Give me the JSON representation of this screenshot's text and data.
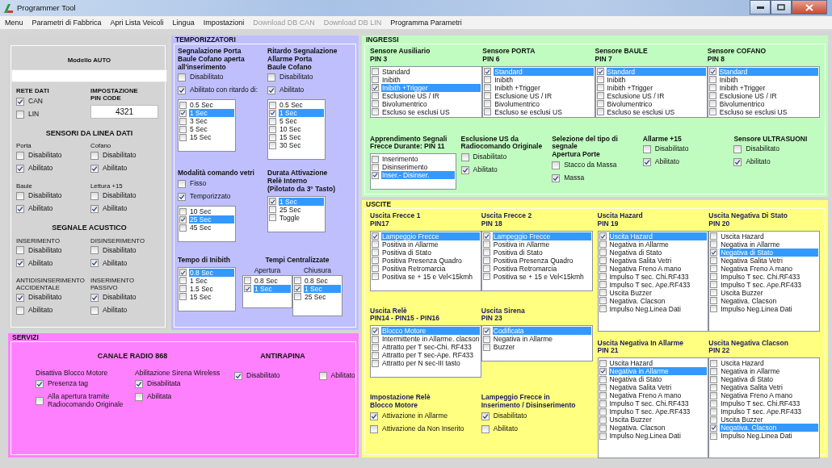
{
  "window": {
    "title": "Programmer Tool"
  },
  "menu": [
    {
      "label": "Menu",
      "disabled": false
    },
    {
      "label": "Parametri di Fabbrica",
      "disabled": false
    },
    {
      "label": "Apri Lista Veicoli",
      "disabled": false
    },
    {
      "label": "Lingua",
      "disabled": false
    },
    {
      "label": "Impostazioni",
      "disabled": false
    },
    {
      "label": "Download DB CAN",
      "disabled": true
    },
    {
      "label": "Download DB LIN",
      "disabled": true
    },
    {
      "label": "Programma Parametri",
      "disabled": false
    }
  ],
  "panels": [
    {
      "color": "#d4d4d4",
      "columns": [
        {
          "rows": [
            {
              "groups": [
                {
                  "kind": "combo",
                  "heading": [
                    "Modello AUTO"
                  ],
                  "bold": true
                }
              ]
            },
            {
              "groups": [
                {
                  "kind": "checks",
                  "heading": [
                    "RETE DATI"
                  ],
                  "bold": true,
                  "items": [
                    {
                      "label": "CAN",
                      "checked": true
                    },
                    {
                      "label": "LIN",
                      "checked": false
                    }
                  ]
                },
                {
                  "kind": "field",
                  "heading": [
                    "IMPOSTAZIONE",
                    "PIN CODE"
                  ],
                  "bold": true,
                  "value": "4321"
                }
              ]
            },
            {
              "groups": [
                {
                  "kind": "title",
                  "heading": [
                    "SENSORI DA LINEA DATI"
                  ],
                  "bold": true
                }
              ]
            },
            {
              "groups": [
                {
                  "kind": "checks",
                  "heading": [
                    "Porta"
                  ],
                  "bold": false,
                  "items": [
                    {
                      "label": "Disabilitato",
                      "checked": false
                    },
                    {
                      "label": "Abilitato",
                      "checked": true
                    }
                  ]
                },
                {
                  "kind": "checks",
                  "heading": [
                    "Cofano"
                  ],
                  "bold": false,
                  "items": [
                    {
                      "label": "Disabilitato",
                      "checked": false
                    },
                    {
                      "label": "Abilitato",
                      "checked": true
                    }
                  ]
                }
              ]
            },
            {
              "groups": [
                {
                  "kind": "checks",
                  "heading": [
                    "Baule"
                  ],
                  "bold": false,
                  "items": [
                    {
                      "label": "Disabilitato",
                      "checked": false
                    },
                    {
                      "label": "Abilitato",
                      "checked": true
                    }
                  ]
                },
                {
                  "kind": "checks",
                  "heading": [
                    "Lettura +15"
                  ],
                  "bold": false,
                  "items": [
                    {
                      "label": "Disabilitato",
                      "checked": false
                    },
                    {
                      "label": "Abilitato",
                      "checked": true
                    }
                  ]
                }
              ]
            },
            {
              "groups": [
                {
                  "kind": "title",
                  "heading": [
                    "SEGNALE ACUSTICO"
                  ],
                  "bold": true
                }
              ]
            },
            {
              "groups": [
                {
                  "kind": "checks",
                  "heading": [
                    "INSERIMENTO"
                  ],
                  "bold": false,
                  "items": [
                    {
                      "label": "Disabilitato",
                      "checked": false
                    },
                    {
                      "label": "Abilitato",
                      "checked": true
                    }
                  ]
                },
                {
                  "kind": "checks",
                  "heading": [
                    "DISINSERIMENTO"
                  ],
                  "bold": false,
                  "items": [
                    {
                      "label": "Disabilitato",
                      "checked": false
                    },
                    {
                      "label": "Abilitato",
                      "checked": true
                    }
                  ]
                }
              ]
            },
            {
              "groups": [
                {
                  "kind": "checks",
                  "heading": [
                    "ANTIDISINSERIMENTO",
                    "ACCIDENTALE"
                  ],
                  "bold": false,
                  "items": [
                    {
                      "label": "Disabilitato",
                      "checked": true
                    },
                    {
                      "label": "Abilitato",
                      "checked": false
                    }
                  ]
                },
                {
                  "kind": "checks",
                  "heading": [
                    "INSERIMENTO",
                    "PASSIVO"
                  ],
                  "bold": false,
                  "items": [
                    {
                      "label": "Disabilitato",
                      "checked": true
                    },
                    {
                      "label": "Abilitato",
                      "checked": false
                    }
                  ]
                }
              ]
            }
          ]
        }
      ]
    },
    {
      "title": "TEMPORIZZATORI",
      "color": "#bfbffd",
      "columns": [
        {
          "rows": [
            {
              "groups": [
                {
                  "kind": "checks-list",
                  "heading": [
                    "Segnalazione Porta",
                    "Baule Cofano aperta",
                    "all'inserimento"
                  ],
                  "bold": true,
                  "items": [
                    {
                      "label": "Disabilitato",
                      "checked": false
                    },
                    {
                      "label": "Abilitato con ritardo di:",
                      "checked": true
                    }
                  ],
                  "list": [
                    {
                      "label": "0.5 Sec",
                      "checked": false,
                      "selected": false
                    },
                    {
                      "label": "1 Sec",
                      "checked": true,
                      "selected": true
                    },
                    {
                      "label": "3 Sec",
                      "checked": false,
                      "selected": false
                    },
                    {
                      "label": "5 Sec",
                      "checked": false,
                      "selected": false
                    },
                    {
                      "label": "15 Sec",
                      "checked": false,
                      "selected": false
                    }
                  ]
                },
                {
                  "kind": "checks-list",
                  "heading": [
                    "Ritardo Segnalazione",
                    "Allarme Porta",
                    "Baule Cofano"
                  ],
                  "bold": true,
                  "items": [
                    {
                      "label": "Disabilitato",
                      "checked": false
                    },
                    {
                      "label": "Abilitato",
                      "checked": true
                    }
                  ],
                  "list": [
                    {
                      "label": "0.5 Sec",
                      "checked": false,
                      "selected": false
                    },
                    {
                      "label": "1 Sec",
                      "checked": true,
                      "selected": true
                    },
                    {
                      "label": "5 Sec",
                      "checked": false,
                      "selected": false
                    },
                    {
                      "label": "10 Sec",
                      "checked": false,
                      "selected": false
                    },
                    {
                      "label": "15 Sec",
                      "checked": false,
                      "selected": false
                    },
                    {
                      "label": "30 Sec",
                      "checked": false,
                      "selected": false
                    }
                  ]
                }
              ]
            },
            {
              "groups": [
                {
                  "kind": "checks-list",
                  "heading": [
                    "Modalità comando vetri"
                  ],
                  "bold": true,
                  "items": [
                    {
                      "label": "Fisso",
                      "checked": false
                    },
                    {
                      "label": "Temporizzato",
                      "checked": true
                    }
                  ],
                  "list": [
                    {
                      "label": "10 Sec",
                      "checked": false,
                      "selected": false
                    },
                    {
                      "label": "25 Sec",
                      "checked": true,
                      "selected": true
                    },
                    {
                      "label": "45 Sec",
                      "checked": false,
                      "selected": false
                    }
                  ]
                },
                {
                  "kind": "list",
                  "heading": [
                    "Durata Attivazione",
                    "Relè Interno",
                    "(Pilotato da 3° Tasto)"
                  ],
                  "bold": true,
                  "list": [
                    {
                      "label": "1 Sec",
                      "checked": true,
                      "selected": true
                    },
                    {
                      "label": "25 Sec",
                      "checked": false,
                      "selected": false
                    },
                    {
                      "label": "Toggle",
                      "checked": false,
                      "selected": false
                    }
                  ]
                }
              ]
            },
            {
              "groups": [
                {
                  "kind": "list",
                  "heading": [
                    "Tempo di Inibith"
                  ],
                  "bold": true,
                  "list": [
                    {
                      "label": "0.8 Sec",
                      "checked": true,
                      "selected": true
                    },
                    {
                      "label": "1 Sec",
                      "checked": false,
                      "selected": false
                    },
                    {
                      "label": "1.5 Sec",
                      "checked": false,
                      "selected": false
                    },
                    {
                      "label": "15 Sec",
                      "checked": false,
                      "selected": false
                    }
                  ]
                },
                {
                  "kind": "split",
                  "heading": [
                    "Tempi Centralizzate"
                  ],
                  "bold": true,
                  "parts": [
                    {
                      "heading": [
                        "Apertura"
                      ],
                      "bold": false,
                      "list": [
                        {
                          "label": "0.8 Sec",
                          "checked": false,
                          "selected": false
                        },
                        {
                          "label": "1 Sec",
                          "checked": true,
                          "selected": true
                        }
                      ]
                    },
                    {
                      "heading": [
                        "Chiusura"
                      ],
                      "bold": false,
                      "list": [
                        {
                          "label": "0.8 Sec",
                          "checked": false,
                          "selected": false
                        },
                        {
                          "label": "1 Sec",
                          "checked": true,
                          "selected": true
                        },
                        {
                          "label": "25 Sec",
                          "checked": false,
                          "selected": false
                        }
                      ]
                    }
                  ]
                }
              ]
            }
          ]
        }
      ]
    },
    {
      "title": "INGRESSI",
      "color": "#c0fcc0",
      "columns": [
        {
          "rows": [
            {
              "groups": [
                {
                  "kind": "list",
                  "heading": [
                    "Sensore Ausiliario",
                    "PIN 3"
                  ],
                  "bold": true,
                  "list": [
                    {
                      "label": "Standard",
                      "checked": false,
                      "selected": false
                    },
                    {
                      "label": "Inibith",
                      "checked": false,
                      "selected": false
                    },
                    {
                      "label": "Inibith +Trigger",
                      "checked": true,
                      "selected": true
                    },
                    {
                      "label": "Esclusione US / IR",
                      "checked": false,
                      "selected": false
                    },
                    {
                      "label": "Bivolumentrico",
                      "checked": false,
                      "selected": false
                    },
                    {
                      "label": "Escluso se esclusi US",
                      "checked": false,
                      "selected": false
                    }
                  ]
                },
                {
                  "kind": "list",
                  "heading": [
                    "Sensore PORTA",
                    "PIN 6"
                  ],
                  "bold": true,
                  "list": [
                    {
                      "label": "Standard",
                      "checked": true,
                      "selected": true
                    },
                    {
                      "label": "Inibith",
                      "checked": false,
                      "selected": false
                    },
                    {
                      "label": "Inibith +Trigger",
                      "checked": false,
                      "selected": false
                    },
                    {
                      "label": "Esclusione US / IR",
                      "checked": false,
                      "selected": false
                    },
                    {
                      "label": "Bivolumentrico",
                      "checked": false,
                      "selected": false
                    },
                    {
                      "label": "Escluso se esclusi US",
                      "checked": false,
                      "selected": false
                    }
                  ]
                },
                {
                  "kind": "list",
                  "heading": [
                    "Sensore BAULE",
                    "PIN 7"
                  ],
                  "bold": true,
                  "list": [
                    {
                      "label": "Standard",
                      "checked": true,
                      "selected": true
                    },
                    {
                      "label": "Inibith",
                      "checked": false,
                      "selected": false
                    },
                    {
                      "label": "Inibith +Trigger",
                      "checked": false,
                      "selected": false
                    },
                    {
                      "label": "Esclusione US / IR",
                      "checked": false,
                      "selected": false
                    },
                    {
                      "label": "Bivolumentrico",
                      "checked": false,
                      "selected": false
                    },
                    {
                      "label": "Escluso se esclusi US",
                      "checked": false,
                      "selected": false
                    }
                  ]
                },
                {
                  "kind": "list",
                  "heading": [
                    "Sensore COFANO",
                    "PIN 8"
                  ],
                  "bold": true,
                  "list": [
                    {
                      "label": "Standard",
                      "checked": true,
                      "selected": true
                    },
                    {
                      "label": "Inibith",
                      "checked": false,
                      "selected": false
                    },
                    {
                      "label": "Inibith +Trigger",
                      "checked": false,
                      "selected": false
                    },
                    {
                      "label": "Esclusione US / IR",
                      "checked": false,
                      "selected": false
                    },
                    {
                      "label": "Bivolumentrico",
                      "checked": false,
                      "selected": false
                    },
                    {
                      "label": "Escluso se esclusi US",
                      "checked": false,
                      "selected": false
                    }
                  ]
                }
              ]
            },
            {
              "groups": [
                {
                  "kind": "list",
                  "heading": [
                    "Apprendimento Segnali",
                    "Frecce Durante:   PIN 11"
                  ],
                  "bold": true,
                  "list": [
                    {
                      "label": "Inserimento",
                      "checked": false,
                      "selected": false
                    },
                    {
                      "label": "Disinserimento",
                      "checked": false,
                      "selected": false
                    },
                    {
                      "label": "Inser.- Disinser.",
                      "checked": true,
                      "selected": true
                    }
                  ]
                },
                {
                  "kind": "checks",
                  "heading": [
                    "Esclusione US da",
                    "Radiocomando Originale"
                  ],
                  "bold": true,
                  "items": [
                    {
                      "label": "Disabilitato",
                      "checked": false
                    },
                    {
                      "label": "Abilitato",
                      "checked": true
                    }
                  ]
                },
                {
                  "kind": "checks",
                  "heading": [
                    "Selezione del tipo di segnale",
                    "Apertura Porte"
                  ],
                  "bold": true,
                  "items": [
                    {
                      "label": "Stacco da Massa",
                      "checked": false
                    },
                    {
                      "label": "Massa",
                      "checked": true
                    }
                  ]
                },
                {
                  "kind": "checks",
                  "heading": [
                    "Allarme +15"
                  ],
                  "bold": true,
                  "items": [
                    {
                      "label": "Disabilitato",
                      "checked": false
                    },
                    {
                      "label": "Abilitato",
                      "checked": true
                    }
                  ]
                },
                {
                  "kind": "checks",
                  "heading": [
                    "Sensore ULTRASUONI"
                  ],
                  "bold": true,
                  "items": [
                    {
                      "label": "Disabilitato",
                      "checked": false
                    },
                    {
                      "label": "Abilitato",
                      "checked": true
                    }
                  ]
                }
              ]
            }
          ]
        }
      ]
    },
    {
      "title": "USCITE",
      "color": "#ffff80",
      "columns": [
        {
          "rows": [
            {
              "groups": [
                {
                  "kind": "list",
                  "heading": [
                    "Uscita Frecce 1",
                    "PIN17"
                  ],
                  "bold": true,
                  "list": [
                    {
                      "label": "Lampeggio Frecce",
                      "checked": true,
                      "selected": true
                    },
                    {
                      "label": "Positiva in Allarme",
                      "checked": false,
                      "selected": false
                    },
                    {
                      "label": "Positiva di Stato",
                      "checked": false,
                      "selected": false
                    },
                    {
                      "label": "Positiva Presenza Quadro",
                      "checked": false,
                      "selected": false
                    },
                    {
                      "label": "Positiva Retromarcia",
                      "checked": false,
                      "selected": false
                    },
                    {
                      "label": "Positiva se + 15 e Vel<15kmh",
                      "checked": false,
                      "selected": false
                    }
                  ]
                },
                {
                  "kind": "list",
                  "heading": [
                    "Uscita Frecce 2",
                    "PIN 18"
                  ],
                  "bold": true,
                  "list": [
                    {
                      "label": "Lampeggio Frecce",
                      "checked": true,
                      "selected": true
                    },
                    {
                      "label": "Positiva in Allarme",
                      "checked": false,
                      "selected": false
                    },
                    {
                      "label": "Positiva di Stato",
                      "checked": false,
                      "selected": false
                    },
                    {
                      "label": "Positiva Presenza Quadro",
                      "checked": false,
                      "selected": false
                    },
                    {
                      "label": "Positiva Retromarcia",
                      "checked": false,
                      "selected": false
                    },
                    {
                      "label": "Positiva se + 15 e Vel<15kmh",
                      "checked": false,
                      "selected": false
                    }
                  ]
                }
              ]
            },
            {
              "groups": [
                {
                  "kind": "list",
                  "heading": [
                    "Uscita Relè",
                    "PIN14 - PIN15 - PIN16"
                  ],
                  "bold": true,
                  "list": [
                    {
                      "label": "Blocco Motore",
                      "checked": true,
                      "selected": true
                    },
                    {
                      "label": "Intermittente in Allarme. clacson",
                      "checked": false,
                      "selected": false
                    },
                    {
                      "label": "Attratto per T sec-Chi. RF433",
                      "checked": false,
                      "selected": false
                    },
                    {
                      "label": "Attratto per T sec-Ape. RF433",
                      "checked": false,
                      "selected": false
                    },
                    {
                      "label": "Attratto per N sec-III tasto",
                      "checked": false,
                      "selected": false
                    }
                  ]
                },
                {
                  "kind": "list",
                  "heading": [
                    "Uscita Sirena",
                    "PIN 23"
                  ],
                  "bold": true,
                  "list": [
                    {
                      "label": "Codificata",
                      "checked": true,
                      "selected": true
                    },
                    {
                      "label": "Negativa in Allarme",
                      "checked": false,
                      "selected": false
                    },
                    {
                      "label": "Buzzer",
                      "checked": false,
                      "selected": false
                    }
                  ]
                }
              ]
            },
            {
              "groups": [
                {
                  "kind": "checks",
                  "heading": [
                    "Impostazione Relè",
                    "Blocco Motore"
                  ],
                  "bold": true,
                  "items": [
                    {
                      "label": "Attivazione in Allarme",
                      "checked": true
                    },
                    {
                      "label": "Attivazione da Non Inserito",
                      "checked": false
                    }
                  ]
                },
                {
                  "kind": "checks",
                  "heading": [
                    "Lampeggio Frecce in",
                    "Inserimento / Disinserimento"
                  ],
                  "bold": true,
                  "items": [
                    {
                      "label": "Disabilitato",
                      "checked": true
                    },
                    {
                      "label": "Abilitato",
                      "checked": false
                    }
                  ]
                }
              ]
            }
          ]
        },
        {
          "rows": [
            {
              "groups": [
                {
                  "kind": "list",
                  "heading": [
                    "Uscita Hazard",
                    "PIN 19"
                  ],
                  "bold": true,
                  "list": [
                    {
                      "label": "Uscita Hazard",
                      "checked": true,
                      "selected": true
                    },
                    {
                      "label": "Negativa in Allarme",
                      "checked": false,
                      "selected": false
                    },
                    {
                      "label": "Negativa di Stato",
                      "checked": false,
                      "selected": false
                    },
                    {
                      "label": "Negativa Salita Vetri",
                      "checked": false,
                      "selected": false
                    },
                    {
                      "label": "Negativa Freno A mano",
                      "checked": false,
                      "selected": false
                    },
                    {
                      "label": "Impulso T sec. Chi.RF433",
                      "checked": false,
                      "selected": false
                    },
                    {
                      "label": "Impulso T sec. Ape.RF433",
                      "checked": false,
                      "selected": false
                    },
                    {
                      "label": "Uscita Buzzer",
                      "checked": false,
                      "selected": false
                    },
                    {
                      "label": "Negativa. Clacson",
                      "checked": false,
                      "selected": false
                    },
                    {
                      "label": "Impulso Neg.Linea Dati",
                      "checked": false,
                      "selected": false
                    }
                  ]
                },
                {
                  "kind": "list",
                  "heading": [
                    "Uscita Negativa Di Stato",
                    "PIN 20"
                  ],
                  "bold": true,
                  "list": [
                    {
                      "label": "Uscita Hazard",
                      "checked": false,
                      "selected": false
                    },
                    {
                      "label": "Negativa in Allarme",
                      "checked": false,
                      "selected": false
                    },
                    {
                      "label": "Negativa di Stato",
                      "checked": true,
                      "selected": true
                    },
                    {
                      "label": "Negativa Salita Vetri",
                      "checked": false,
                      "selected": false
                    },
                    {
                      "label": "Negativa Freno A mano",
                      "checked": false,
                      "selected": false
                    },
                    {
                      "label": "Impulso T sec. Chi.RF433",
                      "checked": false,
                      "selected": false
                    },
                    {
                      "label": "Impulso T sec. Ape.RF433",
                      "checked": false,
                      "selected": false
                    },
                    {
                      "label": "Uscita Buzzer",
                      "checked": false,
                      "selected": false
                    },
                    {
                      "label": "Negativa. Clacson",
                      "checked": false,
                      "selected": false
                    },
                    {
                      "label": "Impulso Neg.Linea Dati",
                      "checked": false,
                      "selected": false
                    }
                  ]
                }
              ]
            },
            {
              "groups": [
                {
                  "kind": "list",
                  "heading": [
                    "Uscita Negativa In Allarme",
                    "PIN 21"
                  ],
                  "bold": true,
                  "list": [
                    {
                      "label": "Uscita Hazard",
                      "checked": false,
                      "selected": false
                    },
                    {
                      "label": "Negativa in Allarme",
                      "checked": true,
                      "selected": true
                    },
                    {
                      "label": "Negativa di Stato",
                      "checked": false,
                      "selected": false
                    },
                    {
                      "label": "Negativa Salita Vetri",
                      "checked": false,
                      "selected": false
                    },
                    {
                      "label": "Negativa Freno A mano",
                      "checked": false,
                      "selected": false
                    },
                    {
                      "label": "Impulso T sec. Chi.RF433",
                      "checked": false,
                      "selected": false
                    },
                    {
                      "label": "Impulso T sec. Ape.RF433",
                      "checked": false,
                      "selected": false
                    },
                    {
                      "label": "Uscita Buzzer",
                      "checked": false,
                      "selected": false
                    },
                    {
                      "label": "Negativa. Clacson",
                      "checked": false,
                      "selected": false
                    },
                    {
                      "label": "Impulso Neg.Linea Dati",
                      "checked": false,
                      "selected": false
                    }
                  ]
                },
                {
                  "kind": "list",
                  "heading": [
                    "Uscita Negativa Clacson",
                    "PIN 22"
                  ],
                  "bold": true,
                  "list": [
                    {
                      "label": "Uscita Hazard",
                      "checked": false,
                      "selected": false
                    },
                    {
                      "label": "Negativa in Allarme",
                      "checked": false,
                      "selected": false
                    },
                    {
                      "label": "Negativa di Stato",
                      "checked": false,
                      "selected": false
                    },
                    {
                      "label": "Negativa Salita Vetri",
                      "checked": false,
                      "selected": false
                    },
                    {
                      "label": "Negativa Freno A mano",
                      "checked": false,
                      "selected": false
                    },
                    {
                      "label": "Impulso T sec. Chi.RF433",
                      "checked": false,
                      "selected": false
                    },
                    {
                      "label": "Impulso T sec. Ape.RF433",
                      "checked": false,
                      "selected": false
                    },
                    {
                      "label": "Uscita Buzzer",
                      "checked": false,
                      "selected": false
                    },
                    {
                      "label": "Negativa. Clacson",
                      "checked": true,
                      "selected": true
                    },
                    {
                      "label": "Impulso Neg.Linea Dati",
                      "checked": false,
                      "selected": false
                    }
                  ]
                }
              ]
            }
          ]
        }
      ]
    },
    {
      "title": "SERVIZI",
      "color": "#ff80ff",
      "columns": [
        {
          "rows": [
            {
              "groups": [
                {
                  "kind": "title",
                  "heading": [
                    "CANALE RADIO 868"
                  ],
                  "bold": true
                }
              ]
            },
            {
              "groups": [
                {
                  "kind": "checks",
                  "heading": [
                    "Disattiva Blocco Motore"
                  ],
                  "bold": false,
                  "items": [
                    {
                      "label": "Presenza tag",
                      "checked": true
                    },
                    {
                      "label": "Alla apertura tramite Radiocomando Originale",
                      "checked": false
                    }
                  ]
                },
                {
                  "kind": "checks",
                  "heading": [
                    "Abilitazione Sirena Wireless"
                  ],
                  "bold": false,
                  "items": [
                    {
                      "label": "Disabilitata",
                      "checked": true
                    },
                    {
                      "label": "Abilitata",
                      "checked": false
                    }
                  ]
                }
              ]
            }
          ]
        },
        {
          "rows": [
            {
              "groups": [
                {
                  "kind": "title",
                  "heading": [
                    "ANTIRAPINA"
                  ],
                  "bold": true
                }
              ]
            },
            {
              "groups": [
                {
                  "kind": "inline-checks",
                  "items": [
                    {
                      "label": "Disabilitato",
                      "checked": true
                    },
                    {
                      "label": "Abilitato",
                      "checked": false
                    }
                  ]
                }
              ]
            }
          ]
        }
      ]
    }
  ]
}
